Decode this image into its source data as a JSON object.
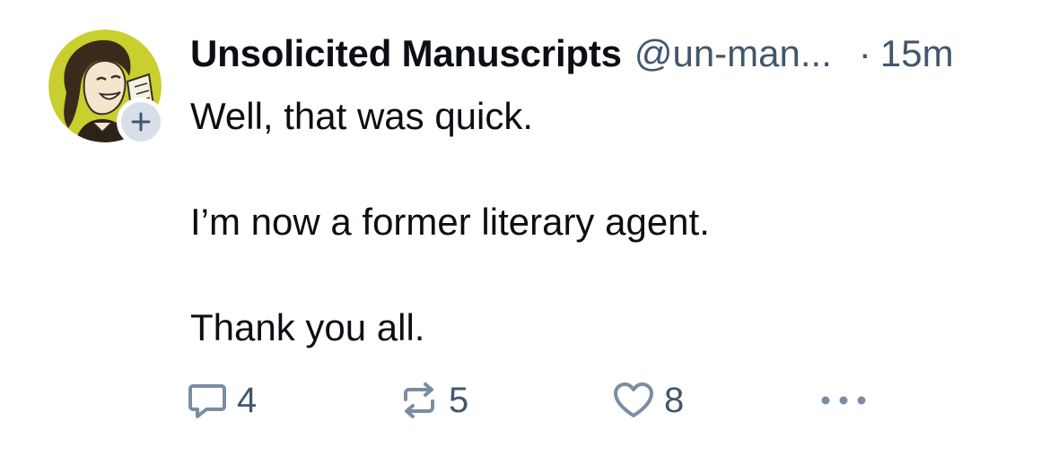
{
  "post": {
    "author": {
      "display_name": "Unsolicited Manuscripts",
      "handle": "@un-man...",
      "avatar_icon": "vintage-woman-reading-avatar",
      "avatar_bg": "#c8cf2e"
    },
    "separator": "·",
    "timestamp": "15m",
    "text": {
      "line1": "Well, that was quick.",
      "line2": "I’m now a former literary agent.",
      "line3": "Thank you all."
    },
    "actions": {
      "reply": {
        "icon": "reply-bubble-icon",
        "count": "4"
      },
      "repost": {
        "icon": "repost-icon",
        "count": "5"
      },
      "like": {
        "icon": "heart-icon",
        "count": "8"
      },
      "more": {
        "icon": "more-dots-icon"
      }
    },
    "follow_badge_icon": "plus-icon"
  },
  "colors": {
    "text": "#0b0f14",
    "muted": "#42576c",
    "icon": "#7a8ea3",
    "badge_bg": "#d8dfe8"
  }
}
